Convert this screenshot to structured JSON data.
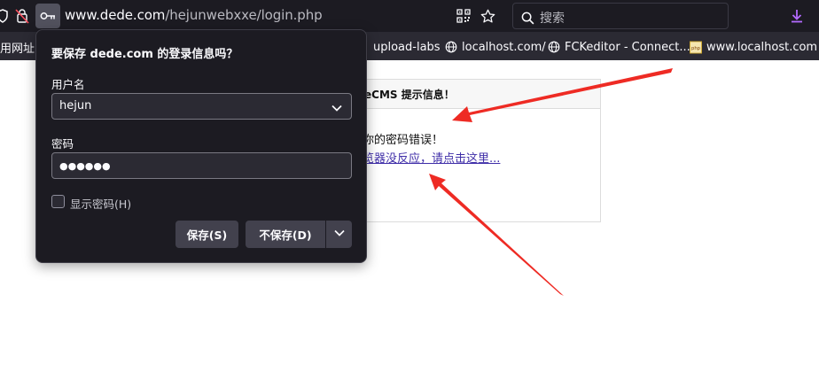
{
  "browser": {
    "url_host": "www.dede.com",
    "url_path": "/hejunwebxxe/login.php",
    "search_placeholder": "搜索"
  },
  "bookmarks": [
    {
      "label": "用网址",
      "icon": "none"
    },
    {
      "label": "upload-labs",
      "icon": "globe-icon"
    },
    {
      "label": "localhost.com/",
      "icon": "globe-icon"
    },
    {
      "label": "FCKeditor - Connect...",
      "icon": "globe-icon"
    },
    {
      "label": "www.localhost.com ...",
      "icon": "php-icon"
    }
  ],
  "page": {
    "box_title": "eCMS 提示信息！",
    "message": "你的密码错误！",
    "link": "览器没反应，请点击这里..."
  },
  "popup": {
    "title": "要保存 dede.com 的登录信息吗？",
    "username_label": "用户名",
    "username_value": "hejun",
    "password_label": "密码",
    "password_value": "●●●●●●",
    "show_password_label": "显示密码(H)",
    "save_button": "保存(S)",
    "dont_save_button": "不保存(D)"
  },
  "colors": {
    "annotation_arrow": "#ee2b24",
    "link": "#3f2ea8"
  }
}
